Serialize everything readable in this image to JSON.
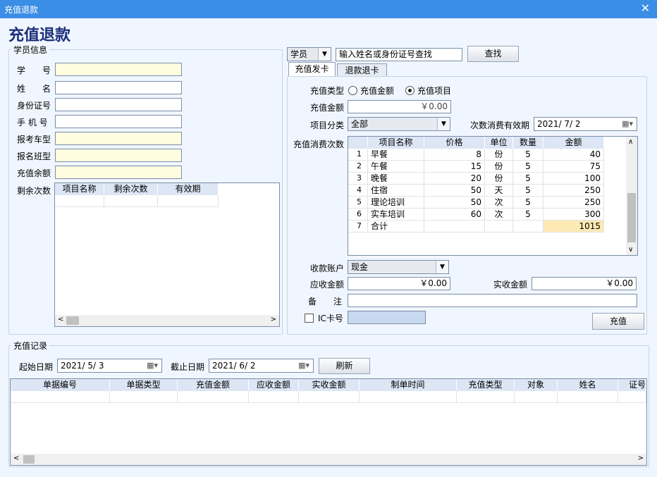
{
  "window": {
    "title": "充值退款",
    "close": "✕"
  },
  "page_title": "充值退款",
  "student_info": {
    "group_label": "学员信息",
    "fields": [
      {
        "label": "学　　号",
        "value": ""
      },
      {
        "label": "姓　　名",
        "value": ""
      },
      {
        "label": "身份证号",
        "value": ""
      },
      {
        "label": "手 机 号",
        "value": ""
      },
      {
        "label": "报考车型",
        "value": ""
      },
      {
        "label": "报名班型",
        "value": ""
      },
      {
        "label": "充值余额",
        "value": ""
      }
    ],
    "remaining_label": "剩余次数",
    "remaining_columns": [
      "项目名称",
      "剩余次数",
      "有效期"
    ]
  },
  "search": {
    "type": "学员",
    "placeholder": "输入姓名或身份证号查找",
    "button": "查找"
  },
  "tabs": [
    "充值发卡",
    "退款退卡"
  ],
  "recharge": {
    "type_label": "充值类型",
    "opt_amount": "充值金额",
    "opt_item": "充值项目",
    "amount_label": "充值金额",
    "amount_value": "￥0.00",
    "category_label": "项目分类",
    "category_value": "全部",
    "validity_label": "次数消费有效期",
    "validity_value": "2021/ 7/ 2",
    "times_label": "充值消费次数",
    "columns": [
      "",
      "项目名称",
      "价格",
      "单位",
      "数量",
      "金额"
    ],
    "rows": [
      [
        "1",
        "早餐",
        "8",
        "份",
        "5",
        "40"
      ],
      [
        "2",
        "午餐",
        "15",
        "份",
        "5",
        "75"
      ],
      [
        "3",
        "晚餐",
        "20",
        "份",
        "5",
        "100"
      ],
      [
        "4",
        "住宿",
        "50",
        "天",
        "5",
        "250"
      ],
      [
        "5",
        "理论培训",
        "50",
        "次",
        "5",
        "250"
      ],
      [
        "6",
        "实车培训",
        "60",
        "次",
        "5",
        "300"
      ],
      [
        "7",
        "合计",
        "",
        "",
        "",
        "1015"
      ]
    ],
    "account_label": "收款账户",
    "account_value": "现金",
    "receivable_label": "应收金额",
    "receivable_value": "￥0.00",
    "received_label": "实收金额",
    "received_value": "￥0.00",
    "remark_label": "备　　注",
    "remark_value": "",
    "ic_label": "IC卡号",
    "ic_value": "",
    "submit": "充值"
  },
  "records": {
    "group_label": "充值记录",
    "start_label": "起始日期",
    "start_value": "2021/ 5/ 3",
    "end_label": "截止日期",
    "end_value": "2021/ 6/ 2",
    "refresh": "刷新",
    "columns": [
      "单据编号",
      "单据类型",
      "充值金额",
      "应收金额",
      "实收金额",
      "制单时间",
      "充值类型",
      "对象",
      "姓名",
      "证号"
    ]
  }
}
